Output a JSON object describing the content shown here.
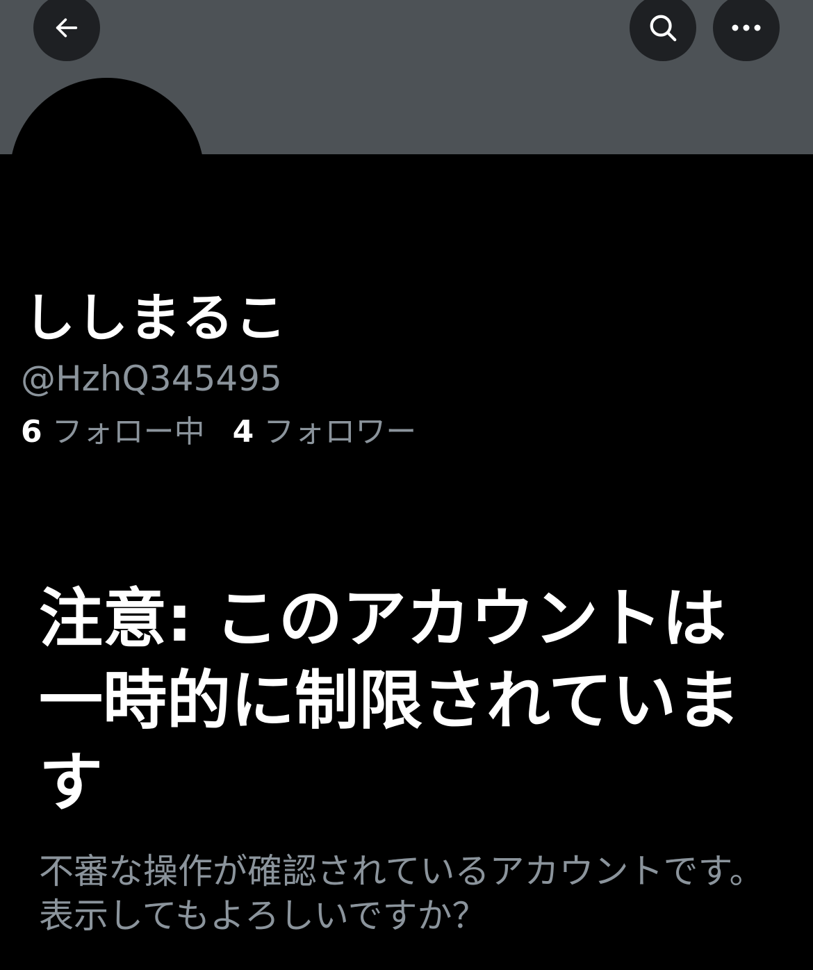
{
  "header": {
    "back_icon": "arrow-left-icon",
    "search_icon": "search-icon",
    "more_icon": "more-horizontal-icon",
    "banner_color": "#4d5256"
  },
  "profile": {
    "display_name": "ししまるこ",
    "handle": "@HzhQ345495",
    "following_count": "6",
    "following_label": "フォロー中",
    "followers_count": "4",
    "followers_label": "フォロワー"
  },
  "warning": {
    "title": "注意: このアカウントは一時的に制限されています",
    "body": "不審な操作が確認されているアカウントです。表示してもよろしいですか？"
  },
  "colors": {
    "background": "#000000",
    "text_primary": "#ffffff",
    "text_secondary": "#8b949c",
    "nav_button": "#1e2023"
  }
}
